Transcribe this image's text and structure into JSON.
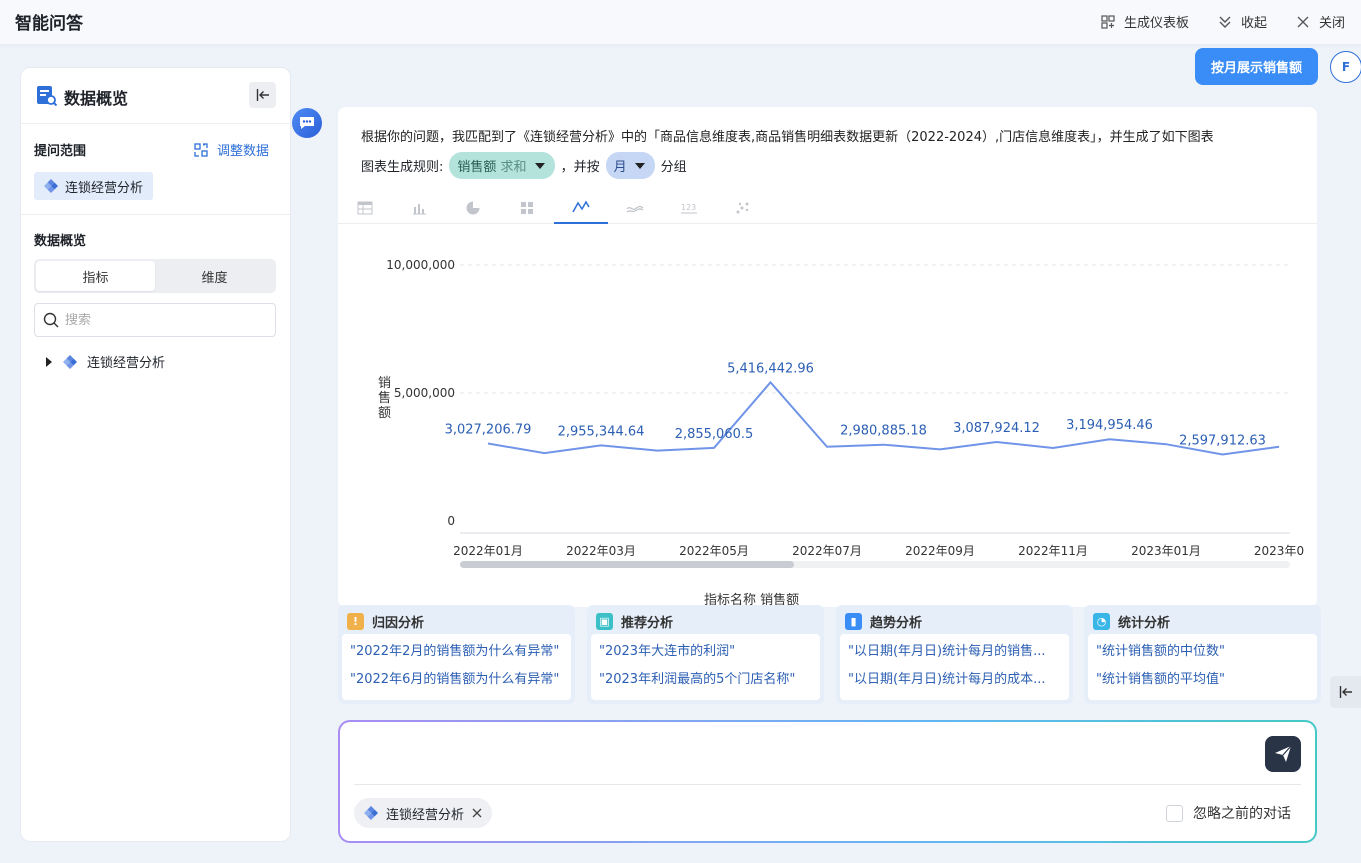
{
  "header": {
    "title": "智能问答",
    "actions": [
      "生成仪表板",
      "收起",
      "关闭"
    ]
  },
  "left_panel": {
    "title": "数据概览",
    "scope_label": "提问范围",
    "adjust_label": "调整数据",
    "scope_chip": "连锁经营分析",
    "overview_label": "数据概览",
    "tabs": [
      "指标",
      "维度"
    ],
    "search_placeholder": "搜索",
    "tree_item": "连锁经营分析"
  },
  "user_message": "按月展示销售额",
  "avatar_letter": "F",
  "answer": {
    "text": "根据你的问题，我匹配到了《连锁经营分析》中的「商品信息维度表,商品销售明细表数据更新（2022-2024）,门店信息维度表」，并生成了如下图表",
    "rule_label": "图表生成规则:",
    "metric_pill": "销售额",
    "metric_agg": "求和",
    "group_prefix": "，并按",
    "group_pill": "月",
    "group_suffix": "分组",
    "chart_tabs": [
      "table-icon",
      "bar-chart-icon",
      "pie-chart-icon",
      "grid-icon",
      "line-chart-icon",
      "area-chart-icon",
      "number-icon",
      "scatter-icon"
    ]
  },
  "chart_data": {
    "type": "line",
    "ylabel": "销售额",
    "ylim": [
      0,
      10000000
    ],
    "y_ticks": [
      "10,000,000",
      "5,000,000",
      "0"
    ],
    "x_tick_labels": [
      "2022年01月",
      "2022年03月",
      "2022年05月",
      "2022年07月",
      "2022年09月",
      "2022年11月",
      "2023年01月",
      "2023年0"
    ],
    "values": [
      3027206.79,
      2650000,
      2955344.64,
      2750000,
      2855060.5,
      5416442.96,
      2900000,
      2980885.18,
      2800000,
      3087924.12,
      2850000,
      3194954.46,
      3000000,
      2597912.63,
      2900000
    ],
    "data_labels": [
      {
        "index": 0,
        "text": "3,027,206.79"
      },
      {
        "index": 2,
        "text": "2,955,344.64"
      },
      {
        "index": 4,
        "text": "2,855,060.5"
      },
      {
        "index": 5,
        "text": "5,416,442.96"
      },
      {
        "index": 7,
        "text": "2,980,885.18"
      },
      {
        "index": 9,
        "text": "3,087,924.12"
      },
      {
        "index": 11,
        "text": "3,194,954.46"
      },
      {
        "index": 13,
        "text": "2,597,912.63"
      }
    ],
    "line_color": "#6f94e8",
    "legend_partial": "指标名称  销售额"
  },
  "suggestions": [
    {
      "title": "归因分析",
      "icon": "warning-icon",
      "color": "#f0b04a",
      "questions": [
        "\"2022年2月的销售额为什么有异常\"",
        "\"2022年6月的销售额为什么有异常\""
      ]
    },
    {
      "title": "推荐分析",
      "icon": "image-icon",
      "color": "#3cc0c8",
      "questions": [
        "\"2023年大连市的利润\"",
        "\"2023年利润最高的5个门店名称\""
      ]
    },
    {
      "title": "趋势分析",
      "icon": "bar-chart-icon",
      "color": "#3a8df6",
      "questions": [
        "\"以日期(年月日)统计每月的销售...",
        "\"以日期(年月日)统计每月的成本..."
      ]
    },
    {
      "title": "统计分析",
      "icon": "pie-icon",
      "color": "#38b6e8",
      "questions": [
        "\"统计销售额的中位数\"",
        "\"统计销售额的平均值\""
      ]
    }
  ],
  "input": {
    "chip": "连锁经营分析",
    "ignore_label": "忽略之前的对话"
  },
  "colors": {
    "accent": "#2e6fd8",
    "user_bubble": "#3a8df6",
    "send_button": "#2a3447"
  }
}
